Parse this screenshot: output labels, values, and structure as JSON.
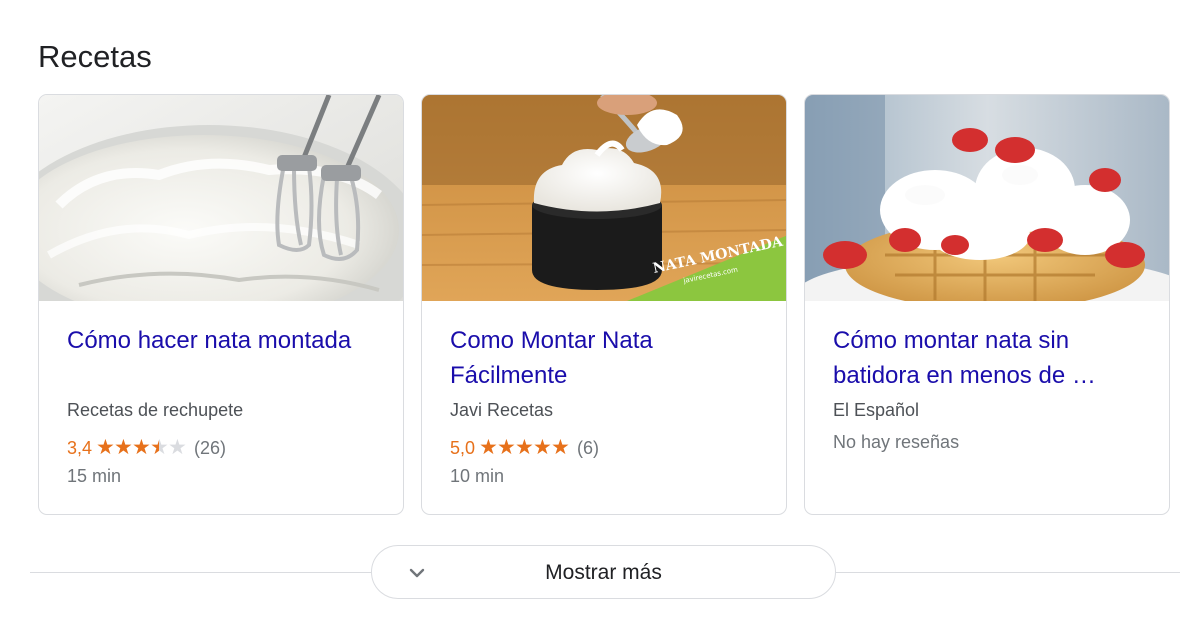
{
  "section": {
    "title": "Recetas"
  },
  "cards": [
    {
      "title": "Cómo hacer nata montada",
      "source": "Recetas de rechupete",
      "rating_value": "3,4",
      "rating": 3.4,
      "review_count": "(26)",
      "time": "15 min",
      "image": "whipped-cream-bowl-mixer"
    },
    {
      "title": "Como Montar Nata Fácilmente",
      "source": "Javi Recetas",
      "rating_value": "5,0",
      "rating": 5.0,
      "review_count": "(6)",
      "time": "10 min",
      "image": "cream-cup-spoon",
      "image_banner": "NATA MONTADA",
      "image_url_text": "javirecetas.com"
    },
    {
      "title": "Cómo montar nata sin batidora en menos de …",
      "source": "El Español",
      "no_reviews": "No hay reseñas",
      "image": "waffle-cream-strawberries"
    }
  ],
  "more": {
    "label": "Mostrar más",
    "icon": "chevron-down-icon"
  },
  "colors": {
    "link": "#1a0dab",
    "star": "#e7711b",
    "border": "#dadce0"
  }
}
